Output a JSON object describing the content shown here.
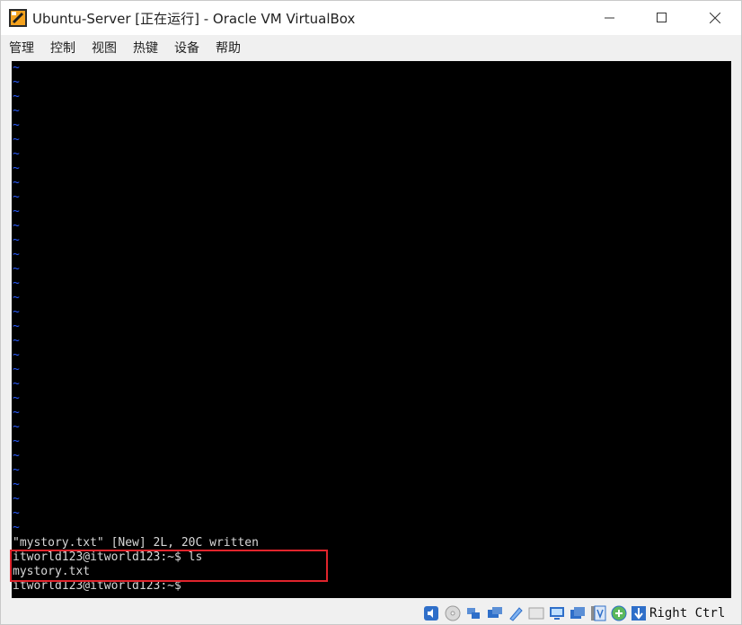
{
  "window": {
    "title": "Ubuntu-Server [正在运行] - Oracle VM VirtualBox"
  },
  "menu": {
    "items": [
      {
        "label": "管理"
      },
      {
        "label": "控制"
      },
      {
        "label": "视图"
      },
      {
        "label": "热键"
      },
      {
        "label": "设备"
      },
      {
        "label": "帮助"
      }
    ]
  },
  "console": {
    "tilde_char": "~",
    "status_line": "\"mystory.txt\" [New] 2L, 20C written",
    "prompt_ls": "itworld123@itworld123:~$ ls",
    "ls_output": "mystory.txt",
    "prompt_current": "itworld123@itworld123:~$",
    "colors": {
      "background": "#000000",
      "text": "#d8d8d8",
      "tilde": "#2b5cff"
    }
  },
  "annotation": {
    "color": "#e0242c"
  },
  "statusbar": {
    "icons": [
      "audio-icon",
      "optical-disk-icon",
      "network-icon",
      "usb-icon",
      "shared-folders-icon",
      "display-icon",
      "display-virtual-icon",
      "video-capture-icon",
      "vt-x-icon",
      "mouse-integration-icon",
      "keyboard-capture-icon"
    ],
    "host_key": "Right Ctrl"
  }
}
